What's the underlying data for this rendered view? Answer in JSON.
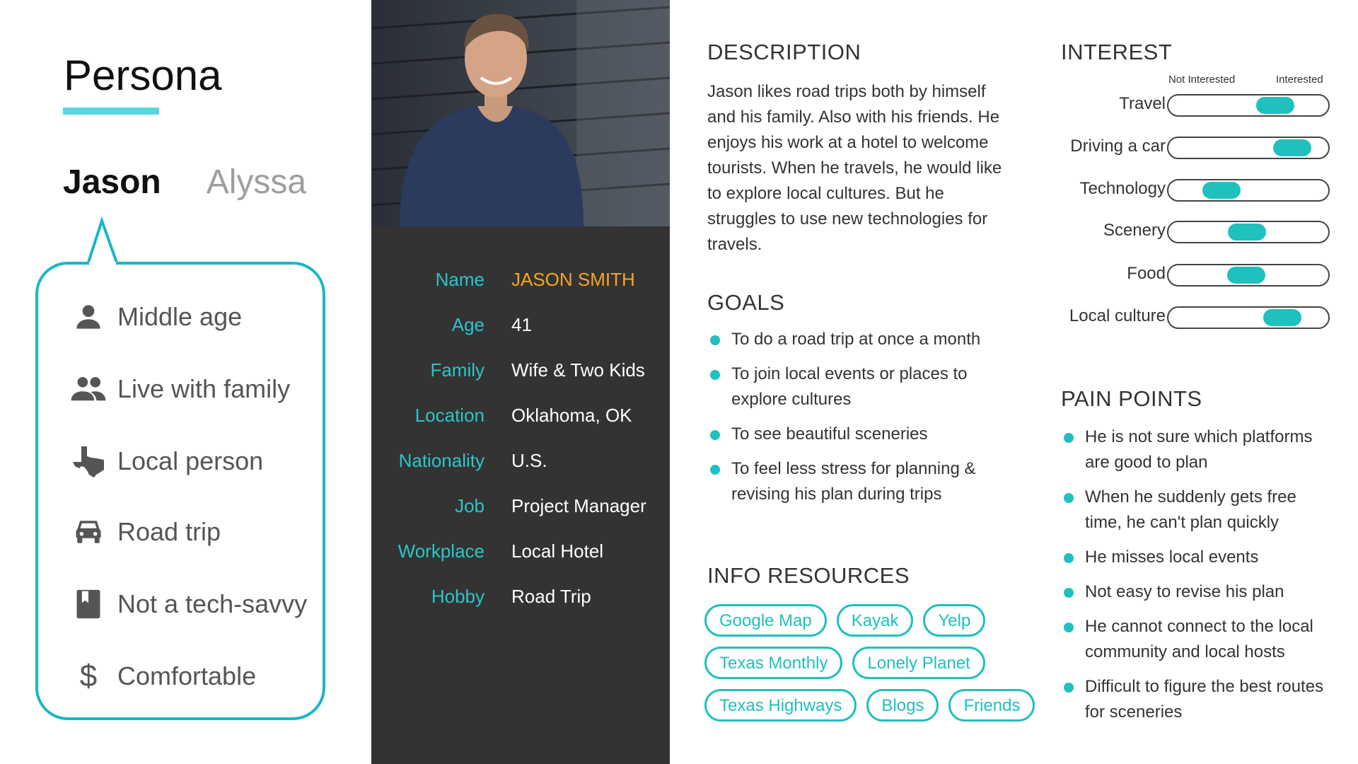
{
  "left": {
    "title": "Persona",
    "tabs": [
      {
        "label": "Jason",
        "active": true
      },
      {
        "label": "Alyssa",
        "active": false
      }
    ],
    "traits": [
      {
        "icon": "person-icon",
        "label": "Middle age"
      },
      {
        "icon": "people-icon",
        "label": "Live with family"
      },
      {
        "icon": "texas-state-icon",
        "label": "Local person"
      },
      {
        "icon": "car-icon",
        "label": "Road trip"
      },
      {
        "icon": "bookmark-icon",
        "label": "Not a tech-savvy"
      },
      {
        "icon": "dollar-icon",
        "label": "Comfortable"
      }
    ]
  },
  "profile": {
    "photo": "portrait-photo",
    "rows": [
      {
        "key": "Name",
        "value": "JASON SMITH"
      },
      {
        "key": "Age",
        "value": "41"
      },
      {
        "key": "Family",
        "value": "Wife & Two Kids"
      },
      {
        "key": "Location",
        "value": "Oklahoma, OK"
      },
      {
        "key": "Nationality",
        "value": "U.S."
      },
      {
        "key": "Job",
        "value": "Project Manager"
      },
      {
        "key": "Workplace",
        "value": "Local Hotel"
      },
      {
        "key": "Hobby",
        "value": "Road Trip"
      }
    ]
  },
  "description": {
    "heading": "DESCRIPTION",
    "text": "Jason likes road trips both by himself and his family. Also with his friends. He enjoys his work at a hotel to welcome tourists. When he travels, he would like to explore local cultures. But he struggles to use new technologies for travels."
  },
  "goals": {
    "heading": "GOALS",
    "items": [
      "To do a road trip at once a month",
      "To join local events or places to explore cultures",
      "To see beautiful sceneries",
      "To feel less stress for planning & revising his plan during trips"
    ]
  },
  "resources": {
    "heading": "INFO RESOURCES",
    "rows": [
      [
        "Google Map",
        "Kayak",
        "Yelp"
      ],
      [
        "Texas Monthly",
        "Lonely Planet"
      ],
      [
        "Texas Highways",
        "Blogs",
        "Friends"
      ]
    ]
  },
  "interest": {
    "heading": "INTEREST",
    "scale_low": "Not Interested",
    "scale_high": "Interested",
    "items": [
      {
        "label": "Travel",
        "level": 0.72
      },
      {
        "label": "Driving a car",
        "level": 0.86
      },
      {
        "label": "Technology",
        "level": 0.28
      },
      {
        "label": "Scenery",
        "level": 0.49
      },
      {
        "label": "Food",
        "level": 0.48
      },
      {
        "label": "Local culture",
        "level": 0.78
      }
    ]
  },
  "pain_points": {
    "heading": "PAIN POINTS",
    "items": [
      "He is not sure which platforms are good to plan",
      "When he suddenly gets free time, he can't plan quickly",
      "He misses local events",
      "Not easy to revise his plan",
      "He cannot connect to the local community and local hosts",
      "Difficult to figure the best routes for sceneries"
    ]
  },
  "colors": {
    "accent": "#1fc0bd",
    "outline": "#19b7c6",
    "name_highlight": "#f5a623",
    "panel_dark": "#333333"
  }
}
